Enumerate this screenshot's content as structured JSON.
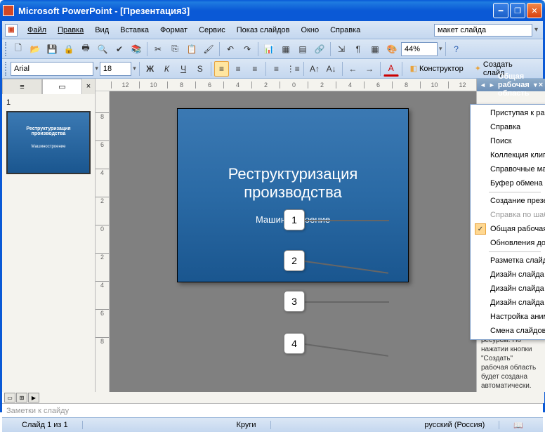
{
  "window": {
    "title": "Microsoft PowerPoint - [Презентация3]"
  },
  "menu": {
    "file": "Файл",
    "edit": "Правка",
    "view": "Вид",
    "insert": "Вставка",
    "format": "Формат",
    "service": "Сервис",
    "slideshow": "Показ слайдов",
    "window": "Окно",
    "help": "Справка",
    "helpbox": "макет слайда"
  },
  "toolbar": {
    "font": "Arial",
    "size": "18",
    "zoom": "44%",
    "design": "Конструктор",
    "newslide": "Создать слайд"
  },
  "ruler": {
    "h": [
      "12",
      "10",
      "8",
      "6",
      "4",
      "2",
      "0",
      "2",
      "4",
      "6",
      "8",
      "10",
      "12"
    ],
    "v": [
      "8",
      "6",
      "4",
      "2",
      "0",
      "2",
      "4",
      "6",
      "8"
    ]
  },
  "thumb": {
    "num": "1",
    "title": "Реструктуризация производства",
    "sub": "Машиностроение"
  },
  "slide": {
    "title": "Реструктуризация производства",
    "subtitle": "Машиностроение"
  },
  "callouts": {
    "c1": "1",
    "c2": "2",
    "c3": "3",
    "c4": "4"
  },
  "taskpane": {
    "title": "Общая рабочая область",
    "items": {
      "start": "Приступая к работе",
      "help": "Справка",
      "search": "Поиск",
      "clips": "Коллекция клипов",
      "ref": "Справочные материалы",
      "clipboard": "Буфер обмена",
      "newpres": "Создание презентации",
      "tmplhelp": "Справка по шаблону",
      "shared": "Общая рабочая область",
      "updates": "Обновления документов",
      "layout": "Разметка слайда",
      "design": "Дизайн слайда",
      "design_color": "Дизайн слайда - Цветовые схемы",
      "design_anim": "Дизайн слайда - Эффекты анимации",
      "custom_anim": "Настройка анимации",
      "transition": "Смена слайдов"
    },
    "footer": "дополнительные ресурсы. По нажатии кнопки \"Создать\" рабочая область будет создана автоматически."
  },
  "notes": "Заметки к слайду",
  "status": {
    "slide": "Слайд 1 из 1",
    "theme": "Круги",
    "lang": "русский (Россия)"
  }
}
